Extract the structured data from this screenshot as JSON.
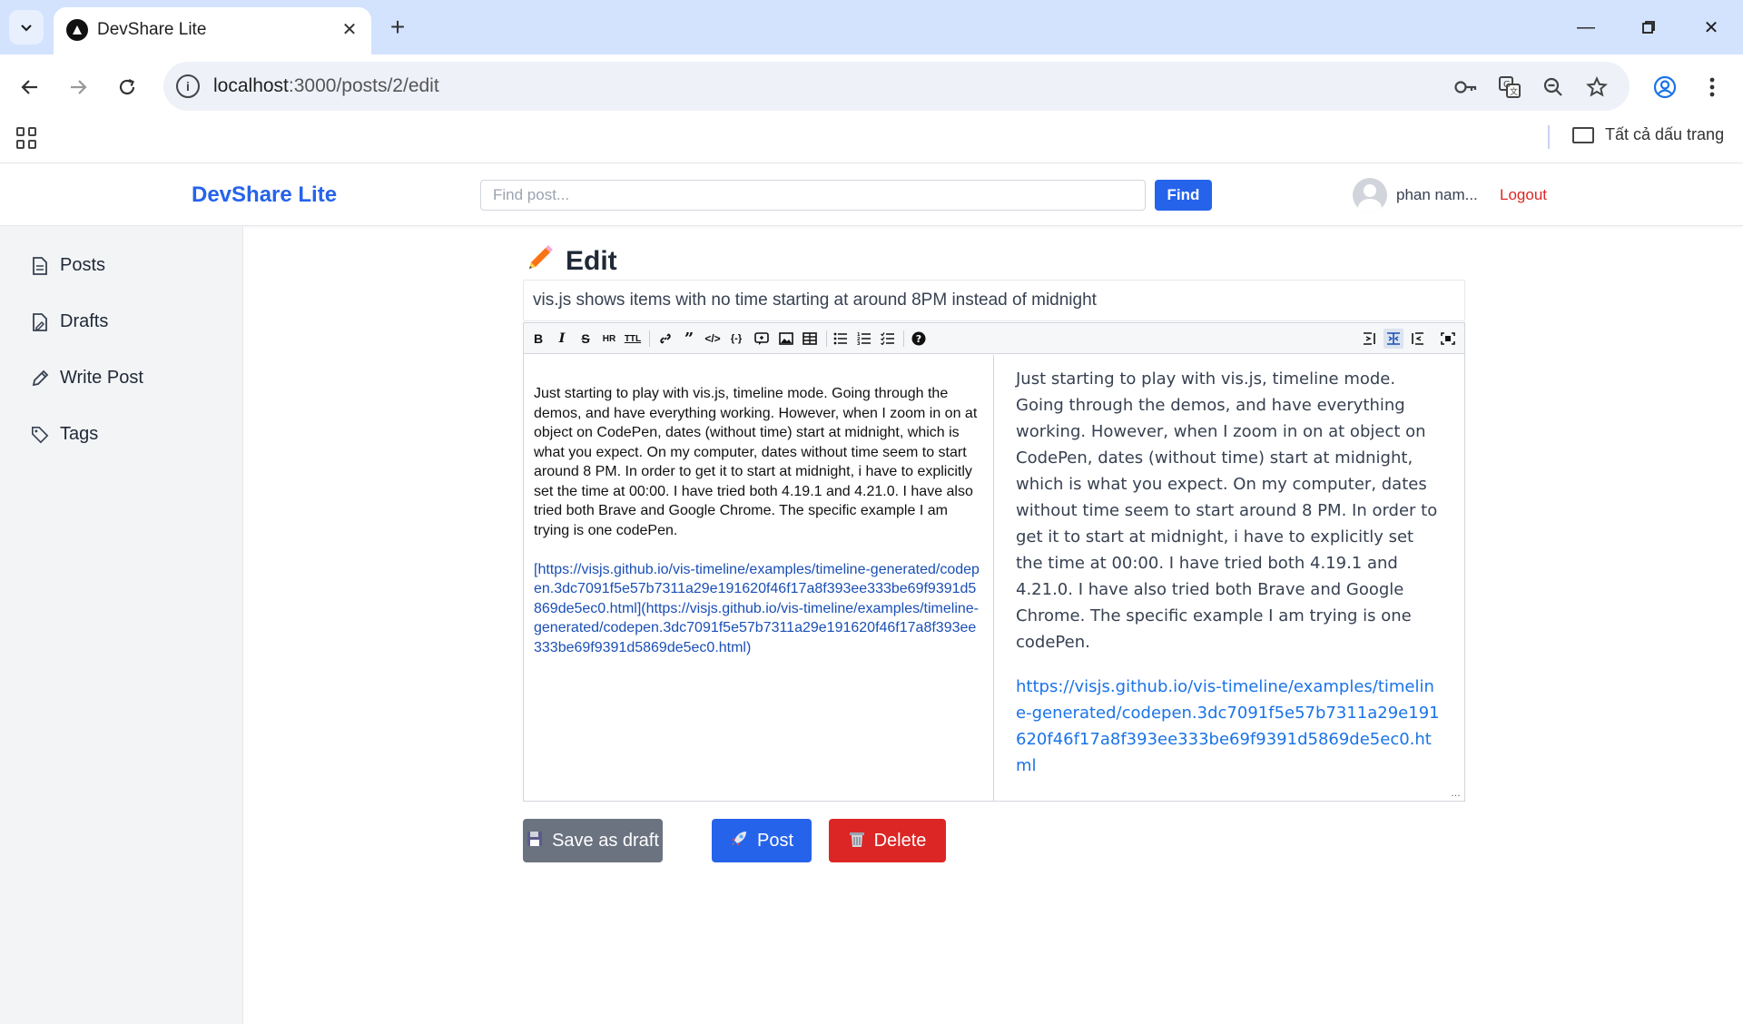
{
  "browser": {
    "tab_title": "DevShare Lite",
    "url_host": "localhost",
    "url_path": ":3000/posts/2/edit",
    "bookmarks_all_label": "Tất cả dấu trang"
  },
  "header": {
    "brand": "DevShare Lite",
    "search_placeholder": "Find post...",
    "find_label": "Find",
    "username": "phan nam...",
    "logout_label": "Logout"
  },
  "sidebar": {
    "items": [
      {
        "label": "Posts",
        "icon": "document-icon"
      },
      {
        "label": "Drafts",
        "icon": "draft-icon"
      },
      {
        "label": "Write Post",
        "icon": "pencil-icon"
      },
      {
        "label": "Tags",
        "icon": "tag-icon"
      }
    ]
  },
  "page": {
    "title": "Edit",
    "title_icon": "pencil-emoji",
    "post_title": "vis.js shows items with no time starting at around 8PM instead of midnight"
  },
  "editor": {
    "toolbar": [
      "bold",
      "italic",
      "strikethrough",
      "hr",
      "title",
      "link",
      "quote",
      "code",
      "code-block",
      "comment",
      "image",
      "table",
      "unordered-list",
      "ordered-list",
      "checked-list",
      "help",
      "edit-only",
      "live",
      "preview-only",
      "fullscreen"
    ],
    "markdown_paragraph": "Just starting to play with vis.js, timeline mode. Going through the demos, and have everything working. However, when I zoom in on at object on CodePen, dates (without time) start at midnight, which is what you expect. On my computer, dates without time seem to start around 8 PM. In order to get it to start at midnight, i have to explicitly set the time at 00:00. I have tried both 4.19.1 and 4.21.0. I have also tried both Brave and Google Chrome. The specific example I am trying is one codePen.",
    "markdown_link": "[https://visjs.github.io/vis-timeline/examples/timeline-generated/codepen.3dc7091f5e57b7311a29e191620f46f17a8f393ee333be69f9391d5869de5ec0.html](https://visjs.github.io/vis-timeline/examples/timeline-generated/codepen.3dc7091f5e57b7311a29e191620f46f17a8f393ee333be69f9391d5869de5ec0.html)",
    "preview_paragraph": "Just starting to play with vis.js, timeline mode. Going through the demos, and have everything working. However, when I zoom in on at object on CodePen, dates (without time) start at midnight, which is what you expect. On my computer, dates without time seem to start around 8 PM. In order to get it to start at midnight, i have to explicitly set the time at 00:00. I have tried both 4.19.1 and 4.21.0. I have also tried both Brave and Google Chrome. The specific example I am trying is one codePen.",
    "preview_link": "https://visjs.github.io/vis-timeline/examples/timeline-generated/codepen.3dc7091f5e57b7311a29e191620f46f17a8f393ee333be69f9391d5869de5ec0.html"
  },
  "actions": {
    "save_draft_label": "Save as draft",
    "post_label": "Post",
    "delete_label": "Delete"
  },
  "colors": {
    "brand": "#2563eb",
    "danger": "#dc2626",
    "secondary": "#6b7280"
  }
}
